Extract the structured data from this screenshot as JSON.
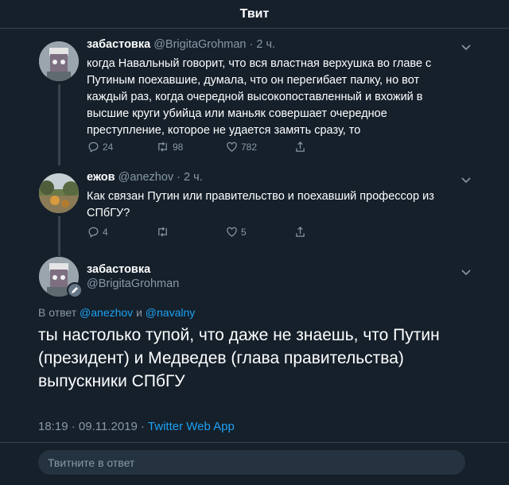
{
  "header": {
    "title": "Твит"
  },
  "tweets": [
    {
      "name": "забастовка",
      "handle": "@BrigitaGrohman",
      "time": "2 ч.",
      "text_lines": [
        "когда Навальный говорит, что вся властная верхушка во главе с",
        "Путиным поехавшие, думала, что он перегибает палку, но вот",
        "каждый раз, когда очередной высокопоставленный и вхожий в",
        "высшие круги убийца или маньяк совершает очередное",
        "преступление, которое  не удается замять сразу, то"
      ],
      "replies": "24",
      "retweets": "98",
      "likes": "782"
    },
    {
      "name": "ежов",
      "handle": "@anezhov",
      "time": "2 ч.",
      "text_lines": [
        "Как связан Путин или правительство и поехавший профессор из",
        "СПбГУ?"
      ],
      "replies": "4",
      "retweets": "",
      "likes": "5"
    }
  ],
  "main": {
    "name": "забастовка",
    "handle": "@BrigitaGrohman",
    "reply_prefix": "В ответ",
    "reply_user1": "@anezhov",
    "reply_and": "и",
    "reply_user2": "@navalny",
    "text_lines": [
      "ты настолько тупой, что даже не знаешь, что Путин",
      "(президент) и  Медведев (глава правительства)",
      "выпускники СПбГУ"
    ],
    "time": "18:19",
    "date": "09.11.2019",
    "app": "Twitter Web App"
  },
  "reply_box": {
    "placeholder": "Твитните в ответ"
  },
  "colors": {
    "background": "#15202b",
    "accent": "#1da1f2",
    "muted": "#8899a6",
    "border": "#38444d"
  }
}
